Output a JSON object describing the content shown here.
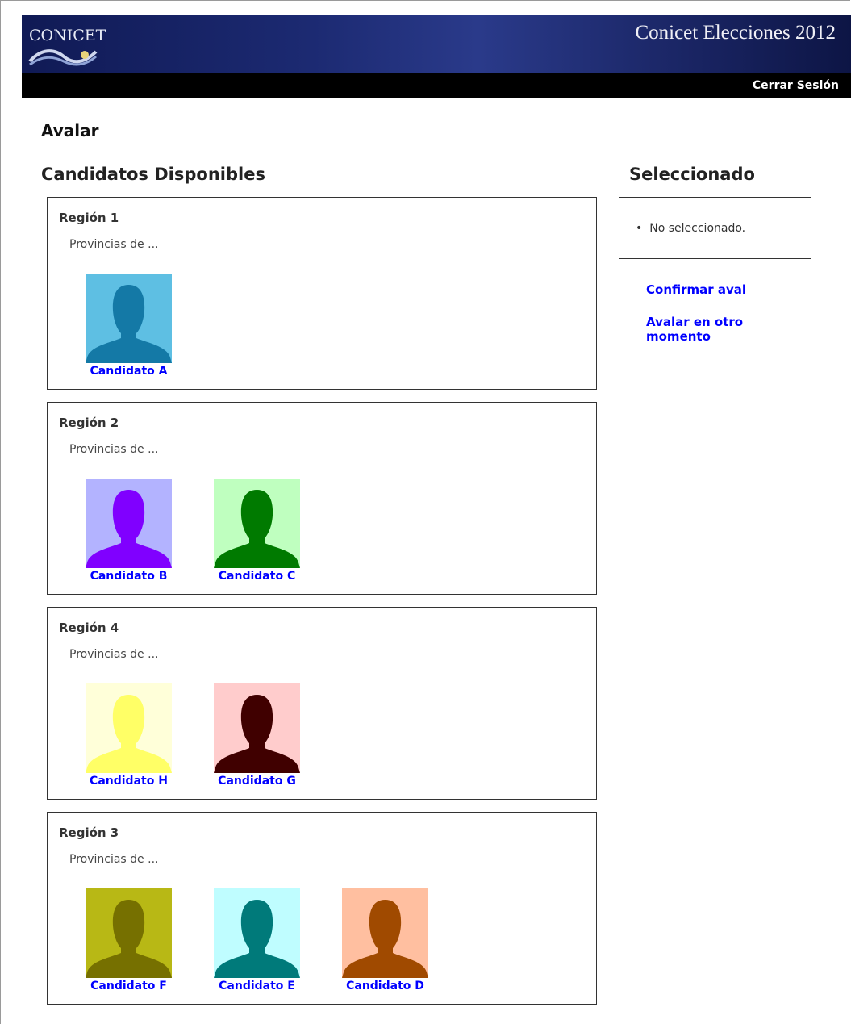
{
  "header": {
    "logo_text": "CONICET",
    "app_title": "Conicet Elecciones 2012",
    "logout_label": "Cerrar Sesión"
  },
  "page": {
    "title": "Avalar",
    "available_title": "Candidatos Disponibles",
    "selected_title": "Seleccionado"
  },
  "regions": [
    {
      "name": "Región 1",
      "desc": "Provincias de ...",
      "candidates": [
        {
          "name": "Candidato A",
          "bg": "#5ebfe3",
          "fg": "#1479a6"
        }
      ]
    },
    {
      "name": "Región 2",
      "desc": "Provincias de ...",
      "candidates": [
        {
          "name": "Candidato B",
          "bg": "#b3b3ff",
          "fg": "#8000ff"
        },
        {
          "name": "Candidato C",
          "bg": "#bfffbf",
          "fg": "#007a00"
        }
      ]
    },
    {
      "name": "Región 4",
      "desc": "Provincias de ...",
      "candidates": [
        {
          "name": "Candidato H",
          "bg": "#ffffd9",
          "fg": "#ffff66"
        },
        {
          "name": "Candidato G",
          "bg": "#ffcccc",
          "fg": "#400000"
        }
      ]
    },
    {
      "name": "Región 3",
      "desc": "Provincias de ...",
      "candidates": [
        {
          "name": "Candidato F",
          "bg": "#b8b815",
          "fg": "#767000"
        },
        {
          "name": "Candidato E",
          "bg": "#bffdff",
          "fg": "#007a7a"
        },
        {
          "name": "Candidato D",
          "bg": "#ffbfa0",
          "fg": "#a04a00"
        }
      ]
    }
  ],
  "selected": {
    "items": [
      "No seleccionado."
    ]
  },
  "actions": {
    "confirm_label": "Confirmar aval",
    "later_label": "Avalar en otro momento"
  },
  "colors": {
    "link": "#0000ff",
    "header_dark": "#101a55",
    "bar": "#000000"
  }
}
